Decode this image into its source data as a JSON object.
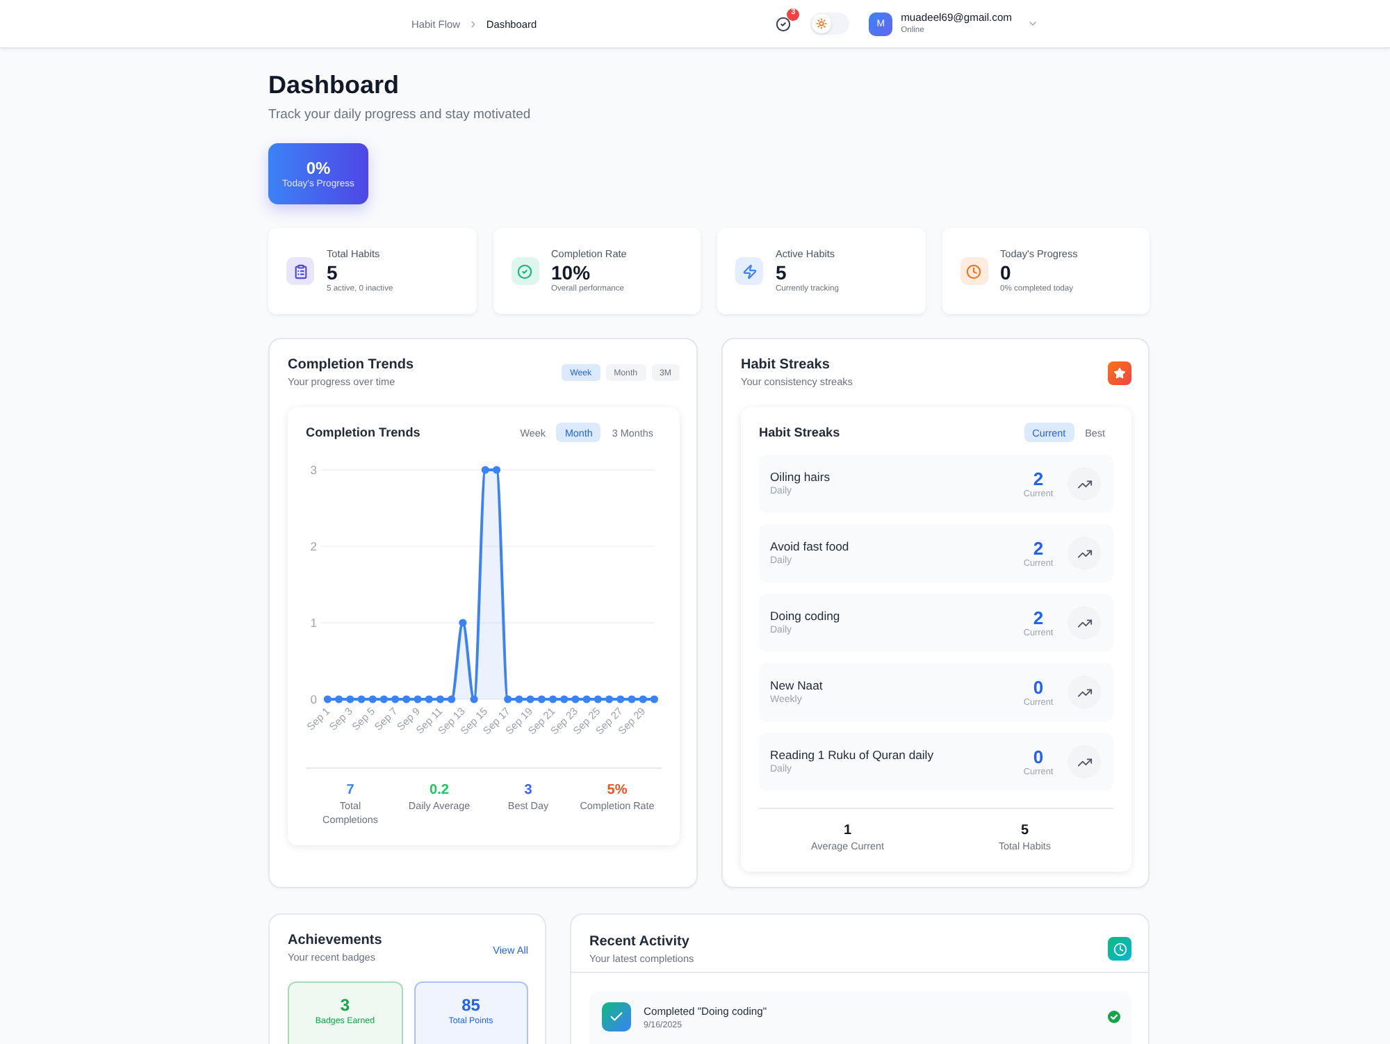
{
  "topbar": {
    "breadcrumb": [
      {
        "label": "Habit Flow",
        "current": false
      },
      {
        "label": "Dashboard",
        "current": true
      }
    ],
    "notifications": {
      "count": "3"
    },
    "theme": {
      "dark_mode": false
    },
    "user": {
      "initial": "M",
      "email": "muadeel69@gmail.com",
      "status": "Online"
    }
  },
  "header": {
    "title": "Dashboard",
    "subtitle": "Track your daily progress and stay motivated"
  },
  "progress_card": {
    "value": "0%",
    "label": "Today's Progress"
  },
  "stats": [
    {
      "label": "Total Habits",
      "value": "5",
      "note": "5 active, 0 inactive",
      "color": "#4f46e5"
    },
    {
      "label": "Completion Rate",
      "value": "10%",
      "note": "Overall performance",
      "color": "#10b981"
    },
    {
      "label": "Active Habits",
      "value": "5",
      "note": "Currently tracking",
      "color": "#3b82f6"
    },
    {
      "label": "Today's Progress",
      "value": "0",
      "note": "0% completed today",
      "color": "#f97316"
    }
  ],
  "completion_trends": {
    "title": "Completion Trends",
    "subtitle": "Your progress over time",
    "ranges": [
      {
        "label": "Week",
        "selected": true
      },
      {
        "label": "Month",
        "selected": false
      },
      {
        "label": "3M",
        "selected": false
      }
    ],
    "card": {
      "title": "Completion Trends",
      "ranges": [
        {
          "label": "Week",
          "selected": false
        },
        {
          "label": "Month",
          "selected": true
        },
        {
          "label": "3 Months",
          "selected": false
        }
      ],
      "chart_data": {
        "type": "area",
        "categories": [
          "Sep 1",
          null,
          "Sep 3",
          null,
          "Sep 5",
          null,
          "Sep 7",
          null,
          "Sep 9",
          null,
          "Sep 11",
          null,
          "Sep 13",
          null,
          "Sep 15",
          null,
          "Sep 17",
          null,
          "Sep 19",
          null,
          "Sep 21",
          null,
          "Sep 23",
          null,
          "Sep 25",
          null,
          "Sep 27",
          null,
          "Sep 29",
          null
        ],
        "series": [
          {
            "color": "#3b82f6",
            "values": [
              0,
              0,
              0,
              0,
              0,
              0,
              0,
              0,
              0,
              0,
              0,
              0,
              1,
              0,
              3,
              3,
              0,
              0,
              0,
              0,
              0,
              0,
              0,
              0,
              0,
              0,
              0,
              0,
              0,
              0
            ]
          }
        ],
        "ylim": [
          0,
          3
        ],
        "yticks": [
          0,
          1,
          2,
          3
        ]
      },
      "summary": [
        {
          "value": "7",
          "label": "Total Completions",
          "color": "#3b82f6"
        },
        {
          "value": "0.2",
          "label": "Daily Average",
          "color": "#22c55e"
        },
        {
          "value": "3",
          "label": "Best Day",
          "color": "#3b63f6"
        },
        {
          "value": "5%",
          "label": "Completion Rate",
          "color": "#f4511e"
        }
      ]
    }
  },
  "habit_streaks": {
    "title": "Habit Streaks",
    "subtitle": "Your consistency streaks",
    "card": {
      "title": "Habit Streaks",
      "modes": [
        {
          "label": "Current",
          "selected": true
        },
        {
          "label": "Best",
          "selected": false
        }
      ],
      "habits": [
        {
          "name": "Oiling hairs",
          "frequency": "Daily",
          "streak": "2",
          "streak_label": "Current"
        },
        {
          "name": "Avoid fast food",
          "frequency": "Daily",
          "streak": "2",
          "streak_label": "Current"
        },
        {
          "name": "Doing coding",
          "frequency": "Daily",
          "streak": "2",
          "streak_label": "Current"
        },
        {
          "name": "New Naat",
          "frequency": "Weekly",
          "streak": "0",
          "streak_label": "Current"
        },
        {
          "name": "Reading 1 Ruku of Quran daily",
          "frequency": "Daily",
          "streak": "0",
          "streak_label": "Current"
        }
      ],
      "summary": [
        {
          "value": "1",
          "label": "Average Current"
        },
        {
          "value": "5",
          "label": "Total Habits"
        }
      ]
    }
  },
  "achievements": {
    "title": "Achievements",
    "subtitle": "Your recent badges",
    "link": "View All",
    "badges": [
      {
        "value": "3",
        "label": "Badges Earned",
        "color": "#16a34a"
      },
      {
        "value": "85",
        "label": "Total Points",
        "color": "#2563eb"
      }
    ]
  },
  "recent_activity": {
    "title": "Recent Activity",
    "subtitle": "Your latest completions",
    "items": [
      {
        "text": "Completed \"Doing coding\"",
        "date": "9/16/2025"
      }
    ]
  }
}
